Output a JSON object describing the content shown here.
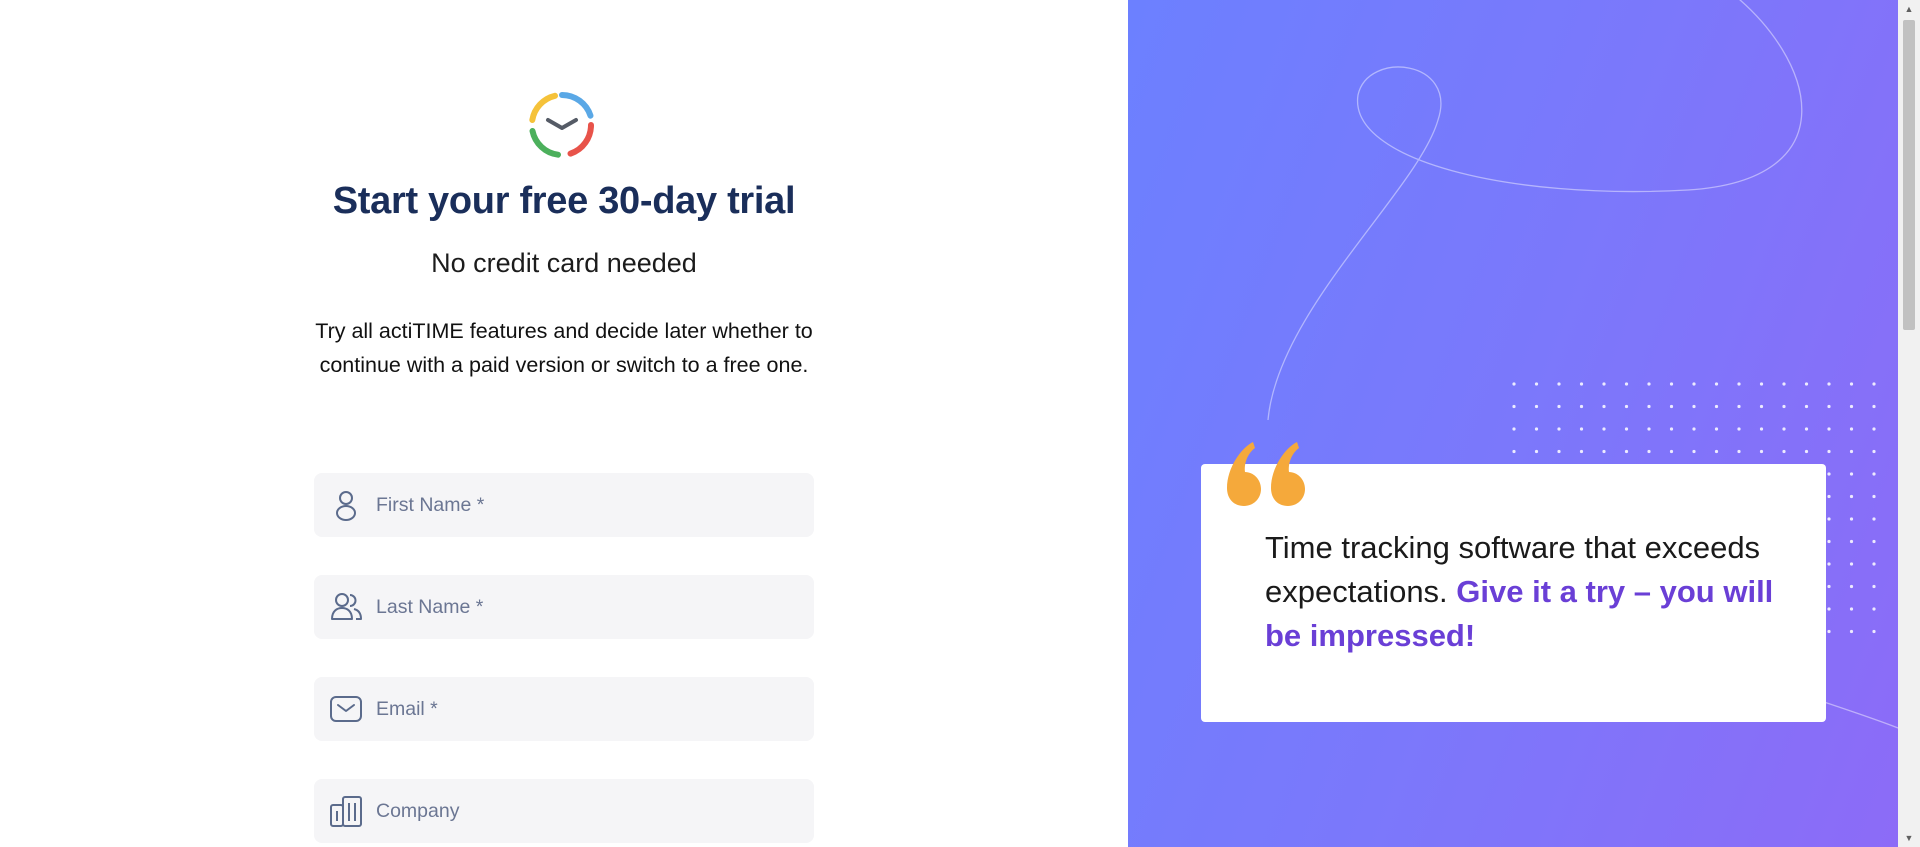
{
  "signup": {
    "logo_icon": "actitime-clock-logo",
    "title": "Start your free 30-day trial",
    "subtitle": "No credit card needed",
    "description": "Try all actiTIME features and decide later whether to continue with a paid version or switch to a free one.",
    "fields": [
      {
        "icon": "user-icon",
        "placeholder": "First Name *",
        "value": ""
      },
      {
        "icon": "users-icon",
        "placeholder": "Last Name *",
        "value": ""
      },
      {
        "icon": "mail-icon",
        "placeholder": "Email *",
        "value": ""
      },
      {
        "icon": "building-icon",
        "placeholder": "Company",
        "value": ""
      }
    ]
  },
  "testimonial": {
    "quote_icon": "quote-mark-icon",
    "text_plain": "Time tracking software that exceeds expectations.",
    "text_highlight": "Give it a try – you will be impressed!"
  },
  "colors": {
    "title": "#1a2e5a",
    "highlight": "#6a3fd6",
    "quote_mark": "#f5a93b",
    "gradient_start": "#6c80ff",
    "gradient_end": "#8c6bf7",
    "field_bg": "#f5f5f7"
  }
}
